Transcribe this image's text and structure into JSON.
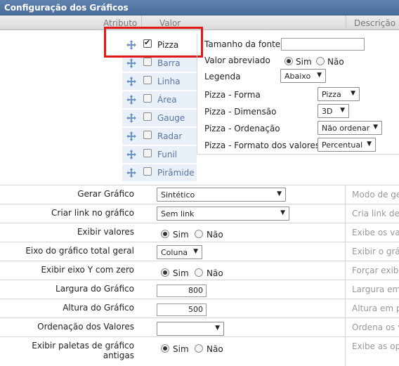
{
  "window": {
    "title": "Configuração dos Gráficos"
  },
  "table_header": {
    "atributo": "Atributo",
    "valor": "Valor",
    "descricao": "Descrição"
  },
  "chart_types": [
    {
      "label": "Pizza",
      "checked": true
    },
    {
      "label": "Barra",
      "checked": false
    },
    {
      "label": "Linha",
      "checked": false
    },
    {
      "label": "Área",
      "checked": false
    },
    {
      "label": "Gauge",
      "checked": false
    },
    {
      "label": "Radar",
      "checked": false
    },
    {
      "label": "Funil",
      "checked": false
    },
    {
      "label": "Pirâmide",
      "checked": false
    }
  ],
  "props": {
    "font_size_label": "Tamanho da fonte",
    "font_size_value": "",
    "abbrev_label": "Valor abreviado",
    "yes": "Sim",
    "no": "Não",
    "legend_label": "Legenda",
    "legend_value": "Abaixo",
    "shape_label": "Pizza - Forma",
    "shape_value": "Pizza",
    "dimension_label": "Pizza - Dimensão",
    "dimension_value": "3D",
    "order_label": "Pizza - Ordenação",
    "order_value": "Não ordenar",
    "format_label": "Pizza - Formato dos valores",
    "format_value": "Percentual"
  },
  "rows": {
    "gerar": {
      "label": "Gerar Gráfico",
      "value": "Sintético",
      "desc": "Modo de gera"
    },
    "link": {
      "label": "Criar link no gráfico",
      "value": "Sem link",
      "desc": "Cria link dem"
    },
    "exibir_valores": {
      "label": "Exibir valores",
      "yes": "Sim",
      "no": "Não",
      "desc": "Exibe os valo"
    },
    "eixo": {
      "label": "Eixo do gráfico total geral",
      "value": "Coluna",
      "desc": "Exibir o gráfi"
    },
    "eixo_y": {
      "label": "Exibir eixo Y com zero",
      "yes": "Sim",
      "no": "Não",
      "desc": "Forçar exibiç"
    },
    "largura": {
      "label": "Largura do Gráfico",
      "value": "800",
      "desc": "Largura em pi"
    },
    "altura": {
      "label": "Altura do Gráfico",
      "value": "500",
      "desc": "Altura em pix"
    },
    "ordenacao": {
      "label": "Ordenação dos Valores",
      "value": "",
      "desc": "Ordena os val"
    },
    "paletas": {
      "label": "Exibir paletas de gráfico antigas",
      "yes": "Sim",
      "no": "Não",
      "desc": "Exibe as opçõ"
    }
  }
}
